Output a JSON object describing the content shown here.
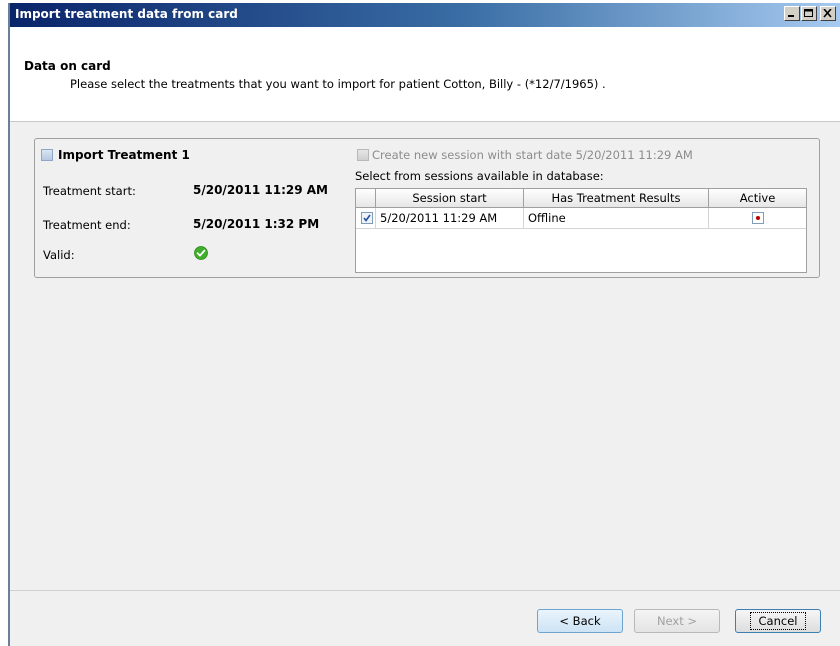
{
  "window": {
    "title": "Import treatment data from card",
    "buttons": [
      "minimize",
      "maximize",
      "close"
    ]
  },
  "header": {
    "title": "Data on card",
    "description": "Please select the treatments that you want to import for patient Cotton, Billy - (*12/7/1965) ."
  },
  "treatment": {
    "title": "Import Treatment 1",
    "checked": false,
    "start_label": "Treatment start:",
    "start_value": "5/20/2011 11:29 AM",
    "end_label": "Treatment end:",
    "end_value": "5/20/2011 1:32 PM",
    "valid_label": "Valid:",
    "valid_icon": "checkmark-success-icon"
  },
  "sessions": {
    "create_label": "Create new session with start date 5/20/2011 11:29 AM",
    "create_enabled": false,
    "select_label": "Select from sessions available in database:",
    "columns": [
      "Session start",
      "Has Treatment Results",
      "Active"
    ],
    "rows": [
      {
        "checked": true,
        "session_start": "5/20/2011 11:29 AM",
        "has_results": "Offline",
        "active": true
      }
    ]
  },
  "footer": {
    "back_label": "< Back",
    "next_label": "Next >",
    "cancel_label": "Cancel"
  }
}
